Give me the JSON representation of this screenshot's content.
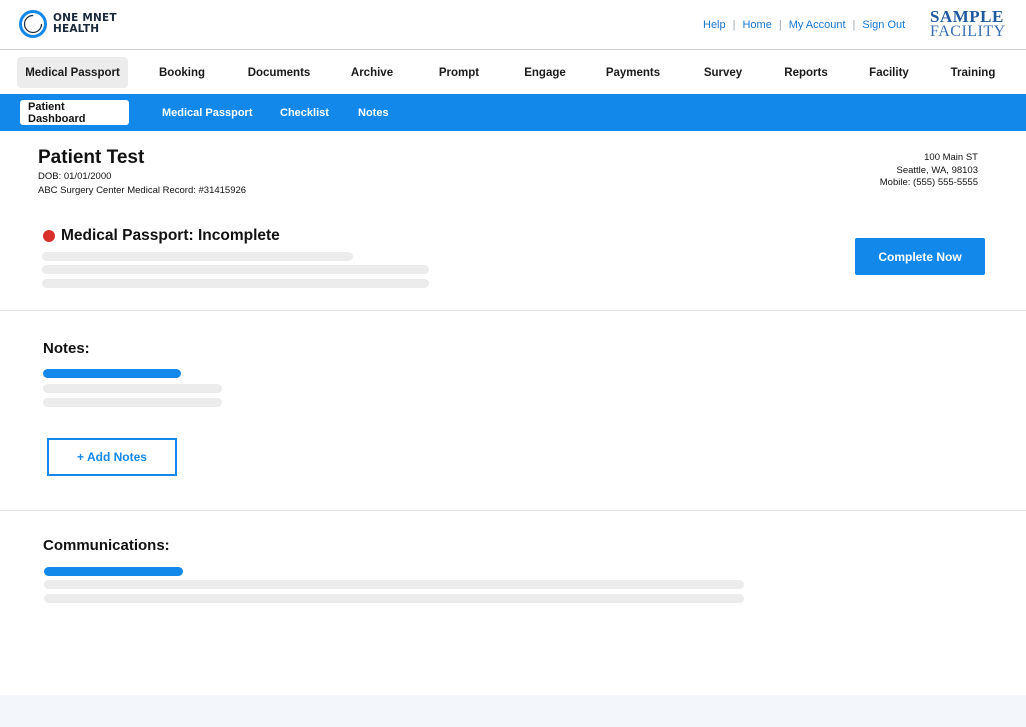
{
  "header": {
    "logo": {
      "line1": "ONE MNET",
      "line2": "HEALTH",
      "icon": "ring-logo-icon"
    },
    "links": [
      "Help",
      "Home",
      "My Account",
      "Sign Out"
    ],
    "facility_logo": {
      "line1": "SAMPLE",
      "line2": "FACILITY"
    }
  },
  "main_nav": {
    "items": [
      "Medical Passport",
      "Booking",
      "Documents",
      "Archive",
      "Prompt",
      "Engage",
      "Payments",
      "Survey",
      "Reports",
      "Facility",
      "Training"
    ],
    "active": "Medical Passport"
  },
  "sub_nav": {
    "items": [
      "Patient Dashboard",
      "Medical Passport",
      "Checklist",
      "Notes"
    ],
    "active": "Patient Dashboard"
  },
  "patient": {
    "name": "Patient Test",
    "dob": "DOB: 01/01/2000",
    "record": "ABC Surgery Center Medical Record: #31415926",
    "address_line1": "100 Main ST",
    "address_line2": "Seattle, WA, 98103",
    "mobile": "Mobile: (555) 555-5555"
  },
  "passport_status": {
    "title": "Medical Passport: Incomplete",
    "status_color": "#d9302b",
    "button_label": "Complete Now"
  },
  "notes": {
    "title": "Notes:",
    "add_button_label": "+ Add Notes"
  },
  "communications": {
    "title": "Communications:"
  },
  "colors": {
    "accent": "#1288ea",
    "link": "#1677d2",
    "skeleton": "#ececec"
  }
}
